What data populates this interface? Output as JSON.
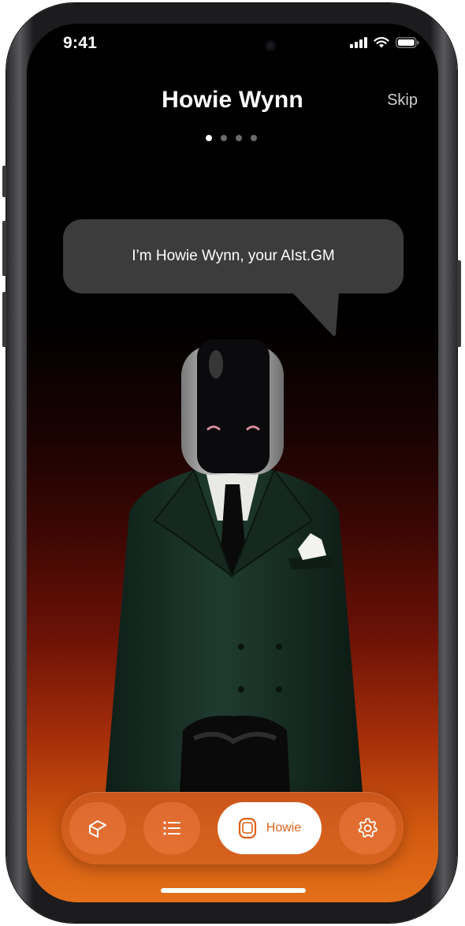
{
  "status_bar": {
    "time": "9:41"
  },
  "header": {
    "title": "Howie Wynn",
    "skip_label": "Skip",
    "pagination": {
      "total": 4,
      "active_index": 0
    }
  },
  "speech_bubble": {
    "text": "I’m Howie Wynn, your AIst.GM"
  },
  "hero": {
    "subject": "robot-gm-in-green-suit"
  },
  "bottom_nav": {
    "items": [
      {
        "icon": "box-icon"
      },
      {
        "icon": "list-icon"
      },
      {
        "icon": "robot-face-icon",
        "label": "Howie",
        "active": true
      },
      {
        "icon": "gear-icon"
      }
    ]
  },
  "colors": {
    "accent": "#e0611a",
    "gradient_bottom": "#e4701a",
    "bubble": "#3c3c3c",
    "suit": "#1e3a2e"
  }
}
